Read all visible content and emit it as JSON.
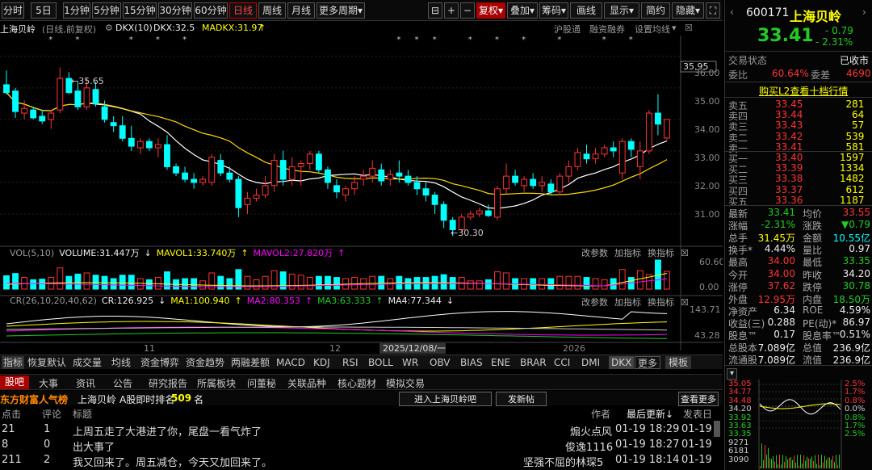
{
  "toolbar": {
    "periods": [
      "分时",
      "5日",
      "1分钟",
      "5分钟",
      "15分钟",
      "30分钟",
      "60分钟",
      "日线",
      "周线",
      "月线",
      "更多周期"
    ],
    "active_period": "日线",
    "right_buttons": [
      "复权",
      "叠加",
      "筹码",
      "画线",
      "显示",
      "简约",
      "隐藏"
    ]
  },
  "stock_title": "上海贝岭",
  "stock_sub": "(日线,前复权)",
  "dkx": {
    "label": "DKX(10)",
    "dkx_val": "DKX:32.5",
    "madkx": "MADKX:31.97"
  },
  "top_links": [
    "沪股通",
    "融资融券",
    "设置均线"
  ],
  "price_axis": {
    "ticks": [
      "36.00",
      "35.00",
      "34.00",
      "33.00",
      "32.00",
      "31.00"
    ],
    "top_tag": "35.95"
  },
  "annotations": {
    "high": "35.65",
    "low": "30.30"
  },
  "vol_panel": {
    "label": "VOL(5,10)",
    "volume": "VOLUME:31.447万",
    "mavol1": "MAVOL1:33.740万",
    "mavol2": "MAVOL2:27.820万",
    "ticks": [
      "60.60",
      "0.00"
    ],
    "tools": [
      "改参数",
      "加指标",
      "换指标"
    ]
  },
  "cr_panel": {
    "label": "CR(26,10,20,40,62)",
    "cr": "CR:126.925",
    "ma1": "MA1:100.940",
    "ma2": "MA2:80.353",
    "ma3": "MA3:63.333",
    "ma4": "MA4:77.344",
    "ticks": [
      "143.71",
      "43.28"
    ],
    "tools": [
      "改参数",
      "加指标",
      "换指标"
    ]
  },
  "x_labels": {
    "m11": "11",
    "m12": "12",
    "date": "2025/12/08/一",
    "y2026": "2026"
  },
  "indicator_tabs": [
    "指标",
    "恢复默认",
    "成交量",
    "均线",
    "资金博弈",
    "资金趋势",
    "两融差额",
    "MACD",
    "KDJ",
    "RSI",
    "BOLL",
    "WR",
    "OBV",
    "BIAS",
    "ENE",
    "BRAR",
    "CCI",
    "DMI",
    "DKX",
    "更多",
    "模板"
  ],
  "bottom_tabs": [
    "股吧",
    "大事",
    "资讯",
    "公告",
    "研究报告",
    "所属板块",
    "问董秘",
    "关联品种",
    "核心题材",
    "模拟交易"
  ],
  "guba": {
    "brand": "东方财富人气榜",
    "stock": "上海贝岭",
    "rank_label": "A股即时排名",
    "rank": "509",
    "rank_unit": "名",
    "enter": "进入上海贝岭吧",
    "post": "发新帖",
    "more": "查看更多"
  },
  "post_headers": {
    "clicks": "点击",
    "comments": "评论",
    "title": "标题",
    "author": "作者",
    "updated": "最后更新↓",
    "posted": "发表日"
  },
  "posts": [
    {
      "clicks": "21",
      "comments": "1",
      "title": "上周五走了大港进了你，尾盘一看气炸了",
      "author": "煽火点风",
      "updated": "01-19 18:29",
      "posted": "01-19"
    },
    {
      "clicks": "8",
      "comments": "0",
      "title": "出大事了",
      "author": "俊逸1116",
      "updated": "01-19 18:27",
      "posted": "01-19"
    },
    {
      "clicks": "211",
      "comments": "2",
      "title": "我又回来了。周五减仓，今天又加回来了。",
      "author": "坚强不屈的林琛5",
      "updated": "01-19 18:14",
      "posted": "01-19"
    }
  ],
  "quote": {
    "code": "600171",
    "name": "上海贝岭",
    "price": "33.41",
    "change": "- 0.79",
    "change_pct": "- 2.31%",
    "status_label": "交易状态",
    "status": "已收市",
    "weibi_label": "委比",
    "weibi": "60.64%",
    "weicha_label": "委差",
    "weicha": "4690",
    "l2_link": "购买L2查看十档行情",
    "asks": [
      {
        "label": "卖五",
        "price": "33.45",
        "vol": "281"
      },
      {
        "label": "卖四",
        "price": "33.44",
        "vol": "64"
      },
      {
        "label": "卖三",
        "price": "33.43",
        "vol": "57"
      },
      {
        "label": "卖二",
        "price": "33.42",
        "vol": "539"
      },
      {
        "label": "卖一",
        "price": "33.41",
        "vol": "581"
      }
    ],
    "bids": [
      {
        "label": "买一",
        "price": "33.40",
        "vol": "1597"
      },
      {
        "label": "买二",
        "price": "33.39",
        "vol": "1334"
      },
      {
        "label": "买三",
        "price": "33.38",
        "vol": "1482"
      },
      {
        "label": "买四",
        "price": "33.37",
        "vol": "612"
      },
      {
        "label": "买五",
        "price": "33.36",
        "vol": "1187"
      }
    ],
    "stats": [
      {
        "l1": "最新",
        "v1": "33.41",
        "c1": "#2c2",
        "l2": "均价",
        "v2": "33.55",
        "c2": "#f33"
      },
      {
        "l1": "涨幅",
        "v1": "-2.31%",
        "c1": "#2c2",
        "l2": "涨跌",
        "v2": "▼0.79",
        "c2": "#2c2"
      },
      {
        "l1": "总手",
        "v1": "31.45万",
        "c1": "#ff0",
        "l2": "金额",
        "v2": "10.55亿",
        "c2": "#0ff"
      },
      {
        "l1": "换手*",
        "v1": "4.44%",
        "c1": "#eee",
        "l2": "量比",
        "v2": "0.97",
        "c2": "#eee"
      },
      {
        "l1": "最高",
        "v1": "34.00",
        "c1": "#f33",
        "l2": "最低",
        "v2": "33.35",
        "c2": "#2c2"
      },
      {
        "l1": "今开",
        "v1": "34.00",
        "c1": "#f33",
        "l2": "昨收",
        "v2": "34.20",
        "c2": "#eee"
      },
      {
        "l1": "涨停",
        "v1": "37.62",
        "c1": "#f33",
        "l2": "跌停",
        "v2": "30.78",
        "c2": "#2c2"
      },
      {
        "l1": "外盘",
        "v1": "12.95万",
        "c1": "#f33",
        "l2": "内盘",
        "v2": "18.50万",
        "c2": "#2c2"
      },
      {
        "l1": "净资产",
        "v1": "6.34",
        "c1": "#eee",
        "l2": "ROE",
        "v2": "4.59%",
        "c2": "#eee"
      },
      {
        "l1": "收益(三)",
        "v1": "0.288",
        "c1": "#eee",
        "l2": "PE(动)*",
        "v2": "86.97",
        "c2": "#eee"
      },
      {
        "l1": "股息™",
        "v1": "0.17",
        "c1": "#eee",
        "l2": "股息率™",
        "v2": "0.51%",
        "c2": "#eee"
      },
      {
        "l1": "总股本",
        "v1": "7.089亿",
        "c1": "#eee",
        "l2": "总值",
        "v2": "236.9亿",
        "c2": "#eee"
      },
      {
        "l1": "流通股",
        "v1": "7.089亿",
        "c1": "#eee",
        "l2": "流值",
        "v2": "236.9亿",
        "c2": "#eee"
      }
    ],
    "mini_left": [
      "35.05",
      "34.77",
      "34.48",
      "34.20",
      "33.92",
      "33.63",
      "33.35",
      "9271",
      "6181",
      "3090"
    ],
    "mini_right": [
      "2.5%",
      "1.7%",
      "0.8%",
      "0.0%",
      "0.8%",
      "1.7%",
      "2.5%"
    ]
  },
  "colors": {
    "up": "#ff3333",
    "down": "#00ffff",
    "ma_yellow": "#ffd700",
    "ma_white": "#ffffff",
    "accent": "#cc0000"
  },
  "chart_data": {
    "type": "candlestick",
    "y_range": [
      30.0,
      36.2
    ],
    "candles": [
      [
        35.1,
        35.55,
        34.8,
        34.85
      ],
      [
        34.9,
        35.0,
        34.05,
        34.25
      ],
      [
        34.2,
        34.6,
        34.0,
        34.35
      ],
      [
        34.3,
        34.4,
        34.0,
        34.05
      ],
      [
        34.1,
        34.3,
        33.85,
        33.95
      ],
      [
        34.0,
        34.3,
        33.7,
        34.2
      ],
      [
        34.3,
        35.65,
        34.2,
        35.3
      ],
      [
        35.3,
        35.5,
        34.8,
        34.85
      ],
      [
        34.9,
        35.2,
        34.3,
        34.4
      ],
      [
        34.4,
        35.3,
        34.3,
        35.0
      ],
      [
        34.95,
        35.2,
        34.4,
        34.5
      ],
      [
        34.4,
        34.6,
        33.9,
        34.0
      ],
      [
        33.9,
        34.1,
        33.6,
        33.8
      ],
      [
        33.8,
        34.1,
        33.3,
        33.4
      ],
      [
        33.4,
        33.8,
        33.0,
        33.15
      ],
      [
        33.1,
        33.4,
        32.9,
        33.3
      ],
      [
        33.3,
        33.4,
        33.0,
        33.1
      ],
      [
        33.1,
        33.4,
        32.8,
        33.2
      ],
      [
        33.2,
        33.5,
        32.4,
        32.5
      ],
      [
        32.5,
        32.6,
        32.2,
        32.3
      ],
      [
        32.3,
        32.5,
        32.0,
        32.1
      ],
      [
        32.1,
        32.3,
        31.8,
        32.0
      ],
      [
        32.0,
        32.2,
        31.9,
        32.1
      ],
      [
        32.0,
        32.9,
        31.9,
        32.8
      ],
      [
        32.7,
        32.9,
        32.2,
        32.3
      ],
      [
        32.3,
        32.5,
        32.0,
        32.1
      ],
      [
        32.1,
        32.2,
        30.9,
        31.2
      ],
      [
        31.3,
        31.7,
        31.0,
        31.5
      ],
      [
        31.5,
        31.8,
        31.4,
        31.6
      ],
      [
        31.6,
        32.2,
        31.5,
        31.9
      ],
      [
        31.9,
        32.9,
        31.7,
        32.7
      ],
      [
        32.7,
        33.0,
        31.9,
        32.1
      ],
      [
        32.1,
        32.8,
        31.9,
        32.5
      ],
      [
        32.5,
        32.7,
        31.9,
        32.6
      ],
      [
        32.6,
        33.0,
        32.4,
        32.9
      ],
      [
        32.9,
        33.0,
        32.3,
        32.4
      ],
      [
        32.4,
        32.5,
        31.8,
        32.0
      ],
      [
        31.9,
        32.1,
        31.5,
        31.7
      ],
      [
        31.6,
        31.9,
        31.4,
        31.8
      ],
      [
        31.8,
        32.2,
        31.6,
        32.0
      ],
      [
        32.1,
        32.4,
        31.9,
        32.2
      ],
      [
        32.2,
        32.7,
        32.0,
        32.45
      ],
      [
        32.4,
        32.6,
        31.9,
        32.05
      ],
      [
        32.1,
        32.4,
        31.9,
        32.25
      ],
      [
        32.3,
        32.7,
        32.0,
        32.2
      ],
      [
        32.2,
        32.4,
        31.9,
        32.0
      ],
      [
        32.0,
        32.2,
        31.6,
        31.8
      ],
      [
        31.8,
        32.0,
        31.4,
        31.6
      ],
      [
        31.6,
        31.7,
        31.0,
        31.3
      ],
      [
        31.3,
        31.4,
        30.55,
        30.8
      ],
      [
        30.8,
        30.9,
        30.3,
        30.5
      ],
      [
        30.5,
        31.0,
        30.4,
        30.9
      ],
      [
        30.9,
        31.1,
        30.8,
        31.0
      ],
      [
        31.0,
        31.2,
        30.9,
        31.1
      ],
      [
        31.1,
        31.3,
        30.9,
        30.95
      ],
      [
        30.9,
        31.9,
        30.8,
        31.8
      ],
      [
        31.8,
        32.6,
        31.6,
        32.2
      ],
      [
        32.2,
        32.4,
        31.9,
        32.0
      ],
      [
        31.9,
        32.2,
        31.7,
        32.1
      ],
      [
        32.1,
        32.3,
        31.8,
        31.9
      ],
      [
        31.9,
        32.2,
        31.7,
        32.0
      ],
      [
        31.95,
        32.1,
        31.6,
        31.7
      ],
      [
        31.7,
        32.3,
        31.6,
        32.2
      ],
      [
        32.2,
        32.7,
        32.0,
        32.5
      ],
      [
        32.5,
        33.1,
        32.4,
        32.95
      ],
      [
        32.9,
        33.2,
        32.6,
        32.75
      ],
      [
        32.75,
        33.1,
        32.6,
        32.9
      ],
      [
        32.9,
        33.2,
        32.8,
        33.1
      ],
      [
        33.1,
        33.3,
        32.8,
        33.0
      ],
      [
        32.3,
        33.4,
        32.1,
        33.3
      ],
      [
        33.3,
        33.4,
        32.8,
        33.05
      ],
      [
        32.5,
        33.3,
        32.1,
        33.0
      ],
      [
        33.0,
        34.3,
        32.9,
        34.2
      ],
      [
        34.2,
        34.8,
        33.5,
        33.85
      ],
      [
        33.41,
        34.0,
        33.35,
        34.0
      ]
    ]
  }
}
